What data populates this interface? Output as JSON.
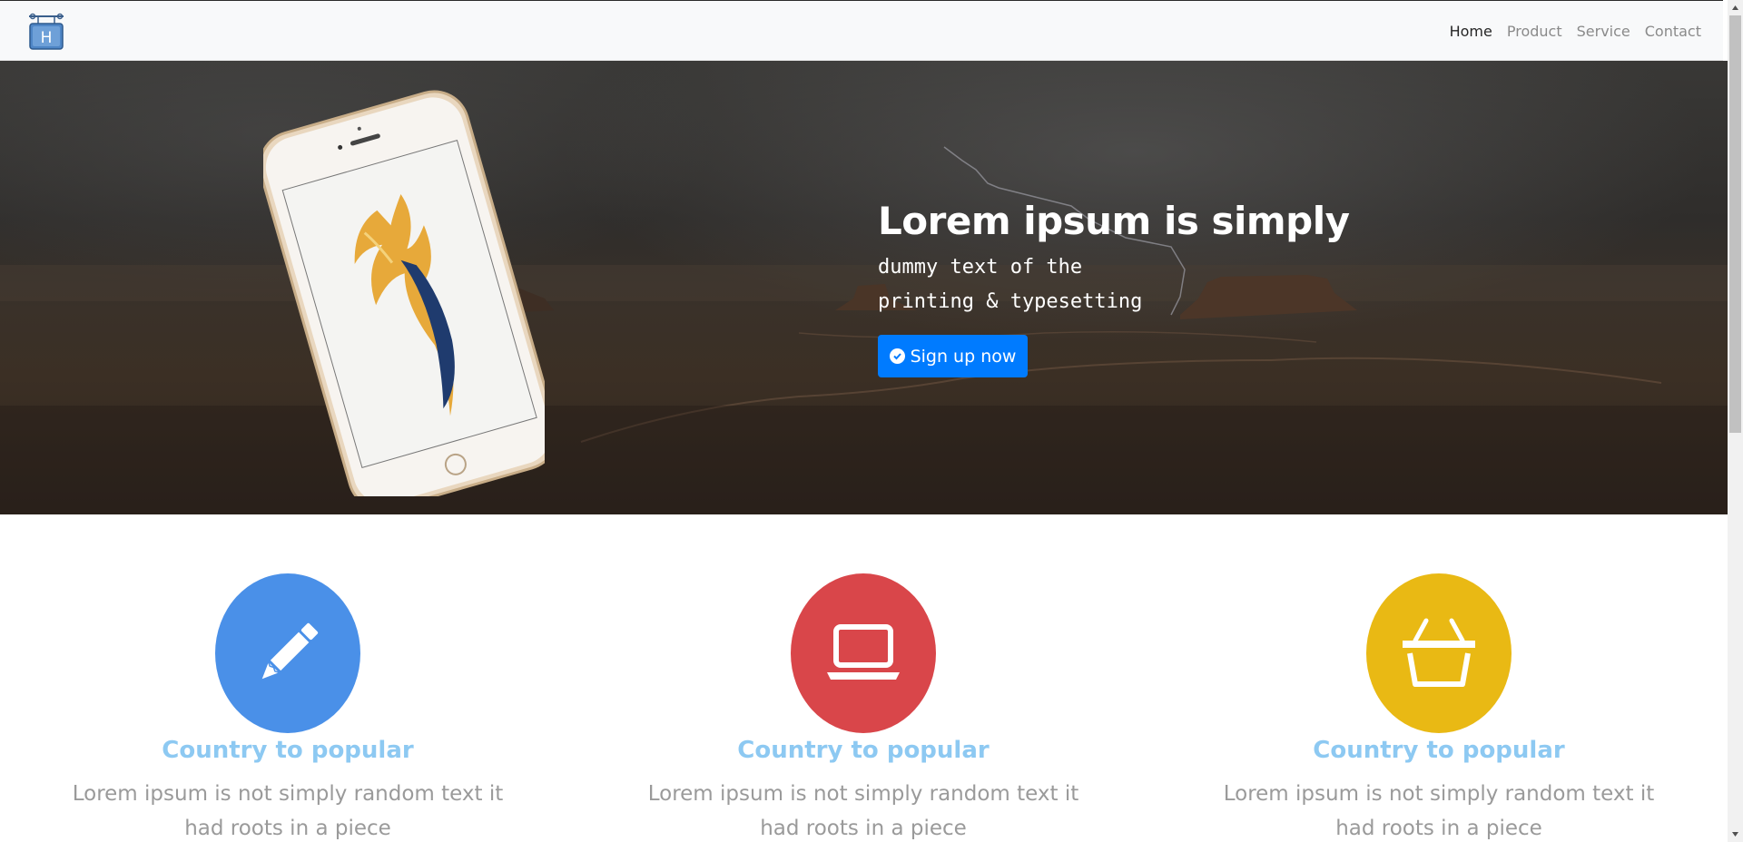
{
  "nav": {
    "logo_letter": "H",
    "links": [
      "Home",
      "Product",
      "Service",
      "Contact"
    ],
    "active": "Home"
  },
  "hero": {
    "title": "Lorem ipsum is simply",
    "subtitle_line1": "dummy text of the",
    "subtitle_line2": "printing & typesetting",
    "button_label": "Sign up now",
    "button_icon": "check-circle-icon",
    "button_color": "#007bff"
  },
  "features": [
    {
      "icon": "pencil-icon",
      "color": "#4a90e8",
      "title": "Country to popular",
      "description": "Lorem ipsum is not simply random text it had roots in a piece"
    },
    {
      "icon": "laptop-icon",
      "color": "#d9464a",
      "title": "Country to popular",
      "description": "Lorem ipsum is not simply random text it had roots in a piece"
    },
    {
      "icon": "basket-icon",
      "color": "#e9b914",
      "title": "Country to popular",
      "description": "Lorem ipsum is not simply random text it had roots in a piece"
    }
  ],
  "colors": {
    "feature_title": "#8dc9f2",
    "feature_text": "#9a9a9a",
    "navbar_bg": "#f8f9fa"
  }
}
